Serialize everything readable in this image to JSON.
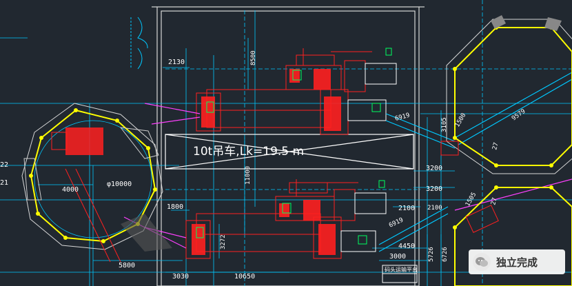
{
  "crane_label": "10t吊车,Lk=19.5 m",
  "dimensions": {
    "d2130": "2130",
    "d8500": "8500",
    "d11000": "11000",
    "d1800": "1800",
    "d3272": "3272",
    "d3030": "3030",
    "d10650": "10650",
    "d5800": "5800",
    "d4000": "4000",
    "d_phi10000": "φ10000",
    "d3200": "3200",
    "d3200b": "3200",
    "d2100": "2100",
    "d4450": "4450",
    "d3000": "3000",
    "d6919": "6919",
    "d6919b": "6919",
    "d9579": "9579",
    "d1500": "1500",
    "d3105": "3105",
    "d5726": "5726",
    "d6726": "6726",
    "d22": "22",
    "d21": "21",
    "d1505": "1505",
    "d27a": "27",
    "d27b": "27",
    "d2100b": "2100"
  },
  "title_block": "码头运输平台",
  "watermark": {
    "text": "独立完成",
    "icon": "wechat-icon"
  },
  "colors": {
    "background": "#212830",
    "red": "#ff2020",
    "cyan": "#00c8ff",
    "yellow": "#ffff00",
    "green": "#00ff60",
    "magenta": "#ff40ff",
    "white": "#ffffff"
  }
}
